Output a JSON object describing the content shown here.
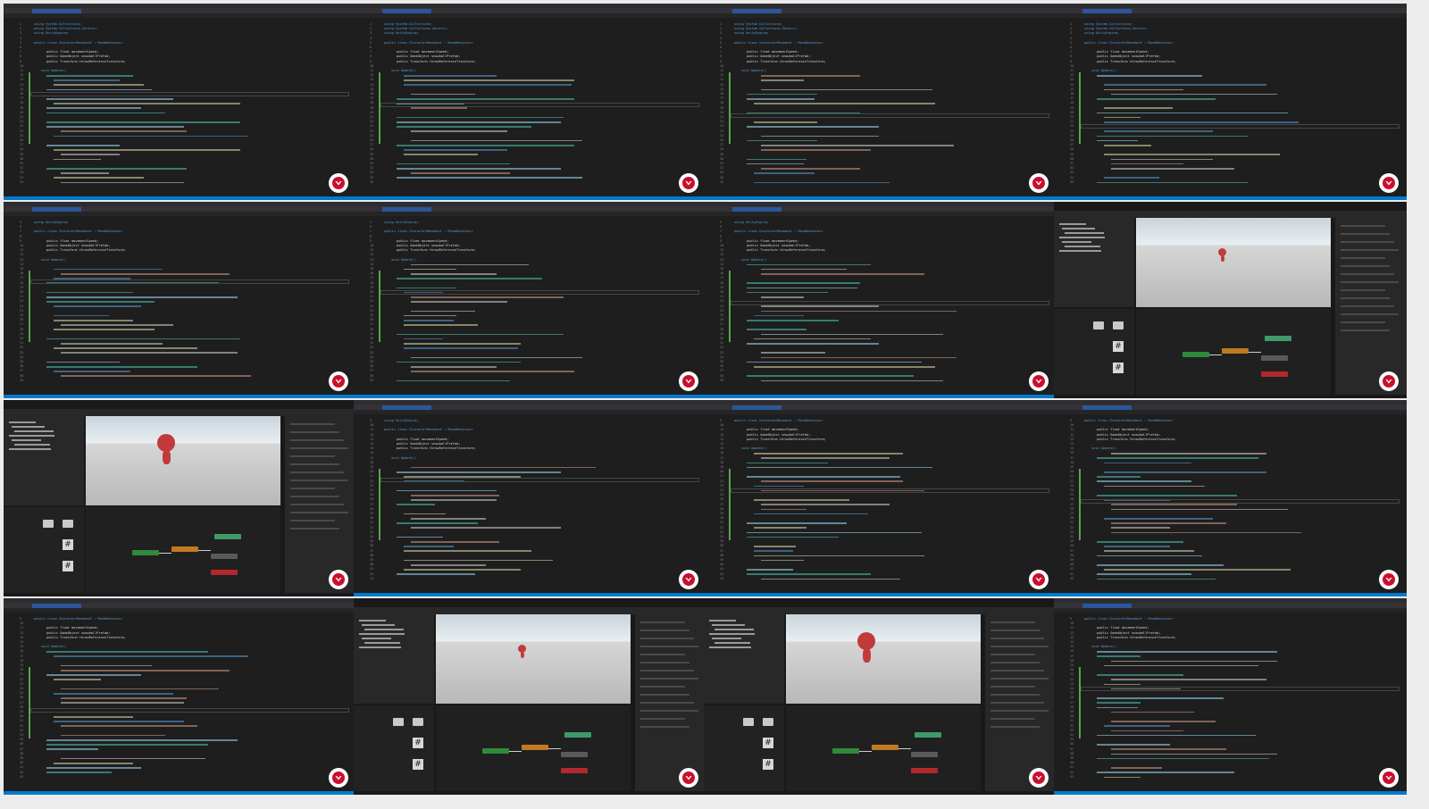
{
  "layout": "contact-sheet-4x4",
  "editor": {
    "project_tab": "CharacterMovement.cs",
    "class_line": "public class CharacterMovement : MonoBehaviour",
    "usings": [
      "using System.Collections;",
      "using System.Collections.Generic;",
      "using UnityEngine;"
    ],
    "fields": [
      "public float movementSpeed;",
      "public GameObject snowballPrefab;",
      "public Transform throwReferenceTransform;"
    ],
    "update_sig": "void Update()"
  },
  "unity": {
    "window_title": "CharacterMovement - SampleScene - Windows, Mac, Linux - Unity 2022.3",
    "animator_states": [
      "Entry",
      "Idle",
      "Walk",
      "Throw",
      "Any State",
      "Exit"
    ]
  },
  "colors": {
    "editor_bg": "#1e1e1e",
    "accent": "#007acc",
    "badge_red": "#c8102e"
  },
  "icons": [
    "logo-badge-icon",
    "folder-icon",
    "script-icon"
  ]
}
